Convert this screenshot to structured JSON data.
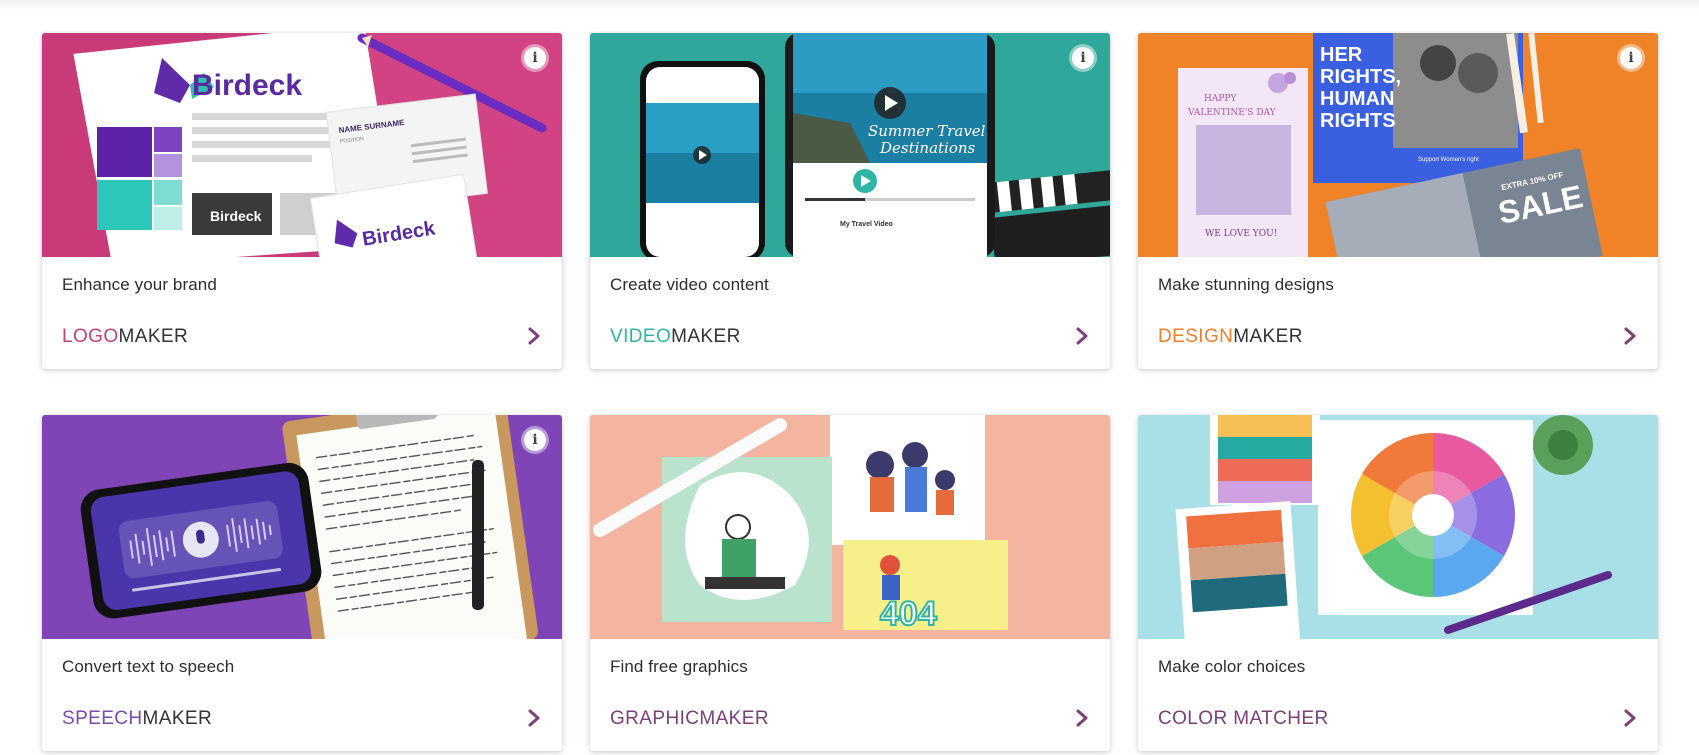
{
  "colors": {
    "logo": "#c3417a",
    "video": "#2fb5a6",
    "design": "#f07f2a",
    "speech": "#7c4aa8",
    "graphic": "#7b3f79",
    "color": "#7b3f79",
    "chevron": "#7b3f79"
  },
  "cards": [
    {
      "caption": "Enhance your brand",
      "product_accent": "LOGO",
      "product_rest": "MAKER",
      "has_info": true,
      "thumb": {
        "brand": "Birdeck",
        "card_name": "NAME SURNAME",
        "card_position": "POSITION"
      }
    },
    {
      "caption": "Create video content",
      "product_accent": "VIDEO",
      "product_rest": "MAKER",
      "has_info": true,
      "thumb": {
        "overlay_line1": "Summer Travel",
        "overlay_line2": "Destinations",
        "video_title": "My Travel Video"
      }
    },
    {
      "caption": "Make stunning designs",
      "product_accent": "DESIGN",
      "product_rest": "MAKER",
      "has_info": true,
      "thumb": {
        "valentine_line1": "HAPPY",
        "valentine_line2": "VALENTINE'S DAY",
        "valentine_footer": "WE LOVE YOU!",
        "poster_line1": "HER",
        "poster_line2": "RIGHTS,",
        "poster_line3": "HUMAN",
        "poster_line4": "RIGHTS",
        "poster_small": "Support Women's right",
        "sale_top": "EXTRA 10% OFF",
        "sale_main": "SALE"
      }
    },
    {
      "caption": "Convert text to speech",
      "product_accent": "SPEECH",
      "product_rest": "MAKER",
      "has_info": true,
      "thumb": {}
    },
    {
      "caption": "Find free graphics",
      "product_accent": "GRAPHICMAKER",
      "product_rest": "",
      "has_info": false,
      "thumb": {
        "error_code": "404"
      }
    },
    {
      "caption": "Make color choices",
      "product_accent": "COLOR MATCHER",
      "product_rest": "",
      "has_info": false,
      "thumb": {}
    }
  ]
}
